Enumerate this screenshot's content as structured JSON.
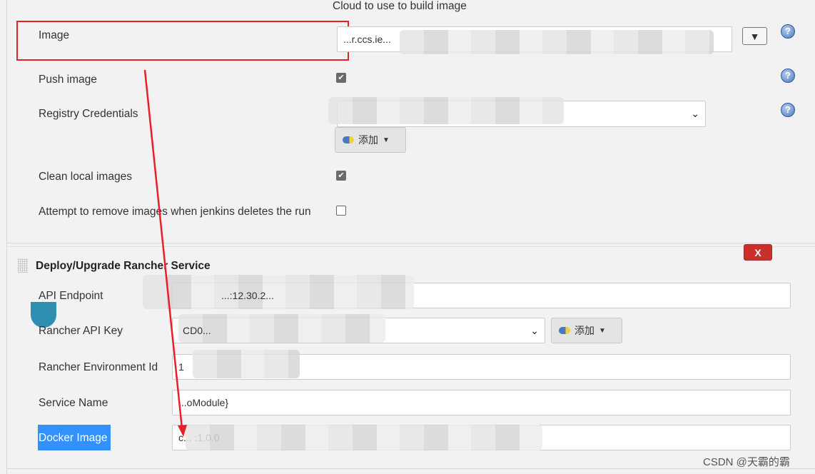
{
  "top_caption": "Cloud to use to build image",
  "docker_build": {
    "image": {
      "label": "Image",
      "value": "...r.ccs.ie..."
    },
    "image_dropdown": "▼",
    "push_image": {
      "label": "Push image",
      "checked": true
    },
    "registry_credentials": {
      "label": "Registry Credentials",
      "value": ""
    },
    "add_button": "添加",
    "clean_local_images": {
      "label": "Clean local images",
      "checked": true
    },
    "attempt_remove": {
      "label": "Attempt to remove images when jenkins deletes the run",
      "checked": false
    }
  },
  "rancher": {
    "title": "Deploy/Upgrade Rancher Service",
    "delete_label": "X",
    "api_endpoint": {
      "label": "API Endpoint",
      "value": "...:12.30.2..."
    },
    "api_key": {
      "label": "Rancher API Key",
      "value": "CD0..."
    },
    "add_button": "添加",
    "environment_id": {
      "label": "Rancher Environment Id",
      "value": "1"
    },
    "service_name": {
      "label": "Service Name",
      "value": "...oModule}"
    },
    "docker_image": {
      "label": "Docker Image",
      "value": "c... :1.0.0"
    }
  },
  "watermark": "CSDN @天霸的霸",
  "colors": {
    "highlight": "#3390ff",
    "annotation": "#e8202a",
    "delete": "#c9302c"
  }
}
